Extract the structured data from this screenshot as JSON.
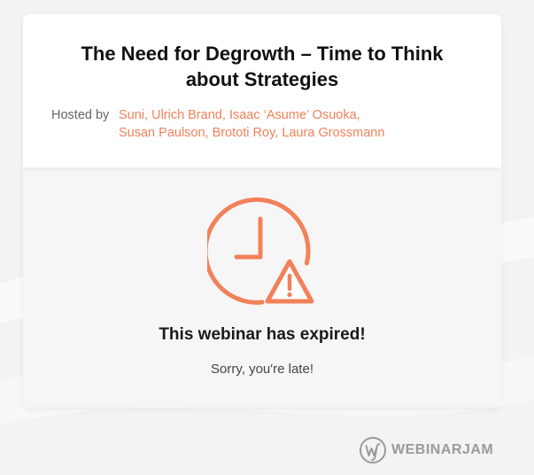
{
  "webinar": {
    "title": "The Need for Degrowth – Time to Think about Strategies",
    "hosted_by_label": "Hosted by",
    "hosts_line1": [
      {
        "name": "Suni",
        "sep": ","
      },
      {
        "name": "Ulrich Brand",
        "sep": ","
      },
      {
        "name": "Isaac ‘Asume’ Osuoka",
        "sep": ","
      }
    ],
    "hosts_line2": [
      {
        "name": "Susan Paulson",
        "sep": ","
      },
      {
        "name": "Brototi Roy",
        "sep": ","
      },
      {
        "name": "Laura Grossmann",
        "sep": ""
      }
    ]
  },
  "status": {
    "icon": "clock-warning-icon",
    "heading": "This webinar has expired!",
    "message": "Sorry, you're late!"
  },
  "footer": {
    "brand_name": "WEBINARJAM",
    "brand_icon": "webinarjam-logo-icon"
  },
  "colors": {
    "accent": "#f28159",
    "title": "#111111",
    "muted": "#666666",
    "background": "#f3f3f3",
    "brand_gray": "#9a9a9a"
  }
}
